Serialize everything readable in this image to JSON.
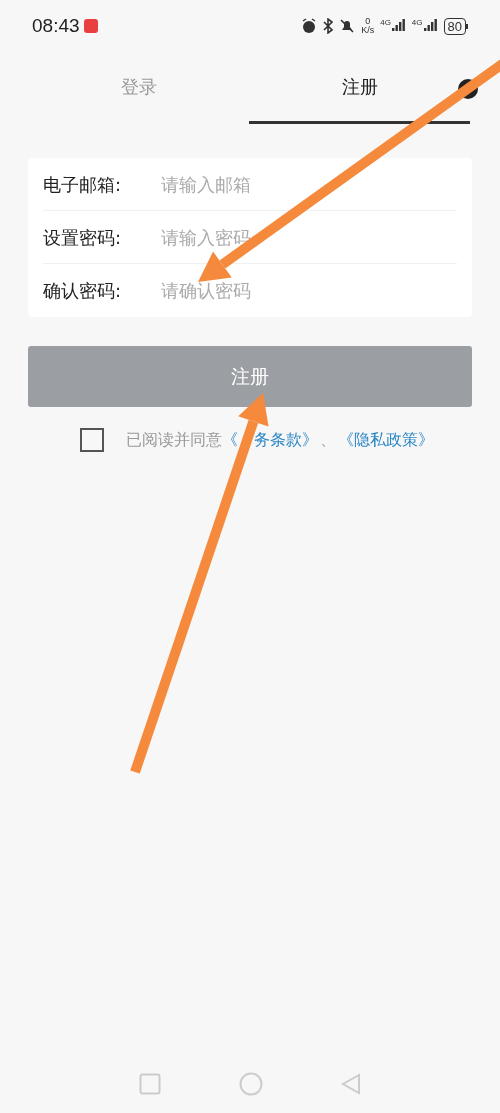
{
  "status_bar": {
    "time": "08:43",
    "speed_value": "0",
    "speed_unit": "K/s",
    "network_1": "4G",
    "network_2": "4G",
    "battery": "80"
  },
  "tabs": [
    {
      "label": "登录",
      "selected": false
    },
    {
      "label": "注册",
      "selected": true
    }
  ],
  "form": {
    "fields": [
      {
        "label": "电子邮箱:",
        "placeholder": "请输入邮箱"
      },
      {
        "label": "设置密码:",
        "placeholder": "请输入密码"
      },
      {
        "label": "确认密码:",
        "placeholder": "请确认密码"
      }
    ]
  },
  "submit_button": "注册",
  "agreement": {
    "checked": false,
    "text": "已阅读并同意",
    "links": [
      {
        "parts": [
          "《",
          "务条款》"
        ]
      },
      {
        "parts": [
          "《隐私政策》"
        ]
      }
    ],
    "separator": "、"
  }
}
